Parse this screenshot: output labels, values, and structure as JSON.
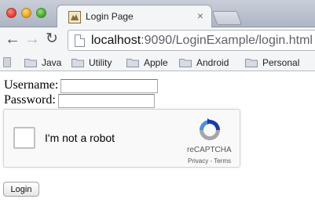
{
  "browser": {
    "tab_title": "Login Page",
    "tab_close": "×",
    "url_host": "localhost",
    "url_rest": ":9090/LoginExample/login.html"
  },
  "bookmarks": [
    {
      "label": "Java",
      "icon": "folder-icon"
    },
    {
      "label": "Utility",
      "icon": "folder-icon"
    },
    {
      "label": "Apple",
      "icon": "folder-icon"
    },
    {
      "label": "Android",
      "icon": "folder-icon"
    },
    {
      "label": "Personal",
      "icon": "folder-icon"
    }
  ],
  "form": {
    "username_label": "Username:",
    "username_value": "",
    "password_label": "Password:",
    "password_value": "",
    "submit_label": "Login"
  },
  "recaptcha": {
    "checkbox_label": "I'm not a robot",
    "brand": "reCAPTCHA",
    "privacy": "Privacy",
    "separator": " - ",
    "terms": "Terms"
  },
  "colors": {
    "recaptcha_blue": "#1c3aa9",
    "recaptcha_lightblue": "#4a90e2",
    "recaptcha_gray": "#a6a6a6"
  }
}
